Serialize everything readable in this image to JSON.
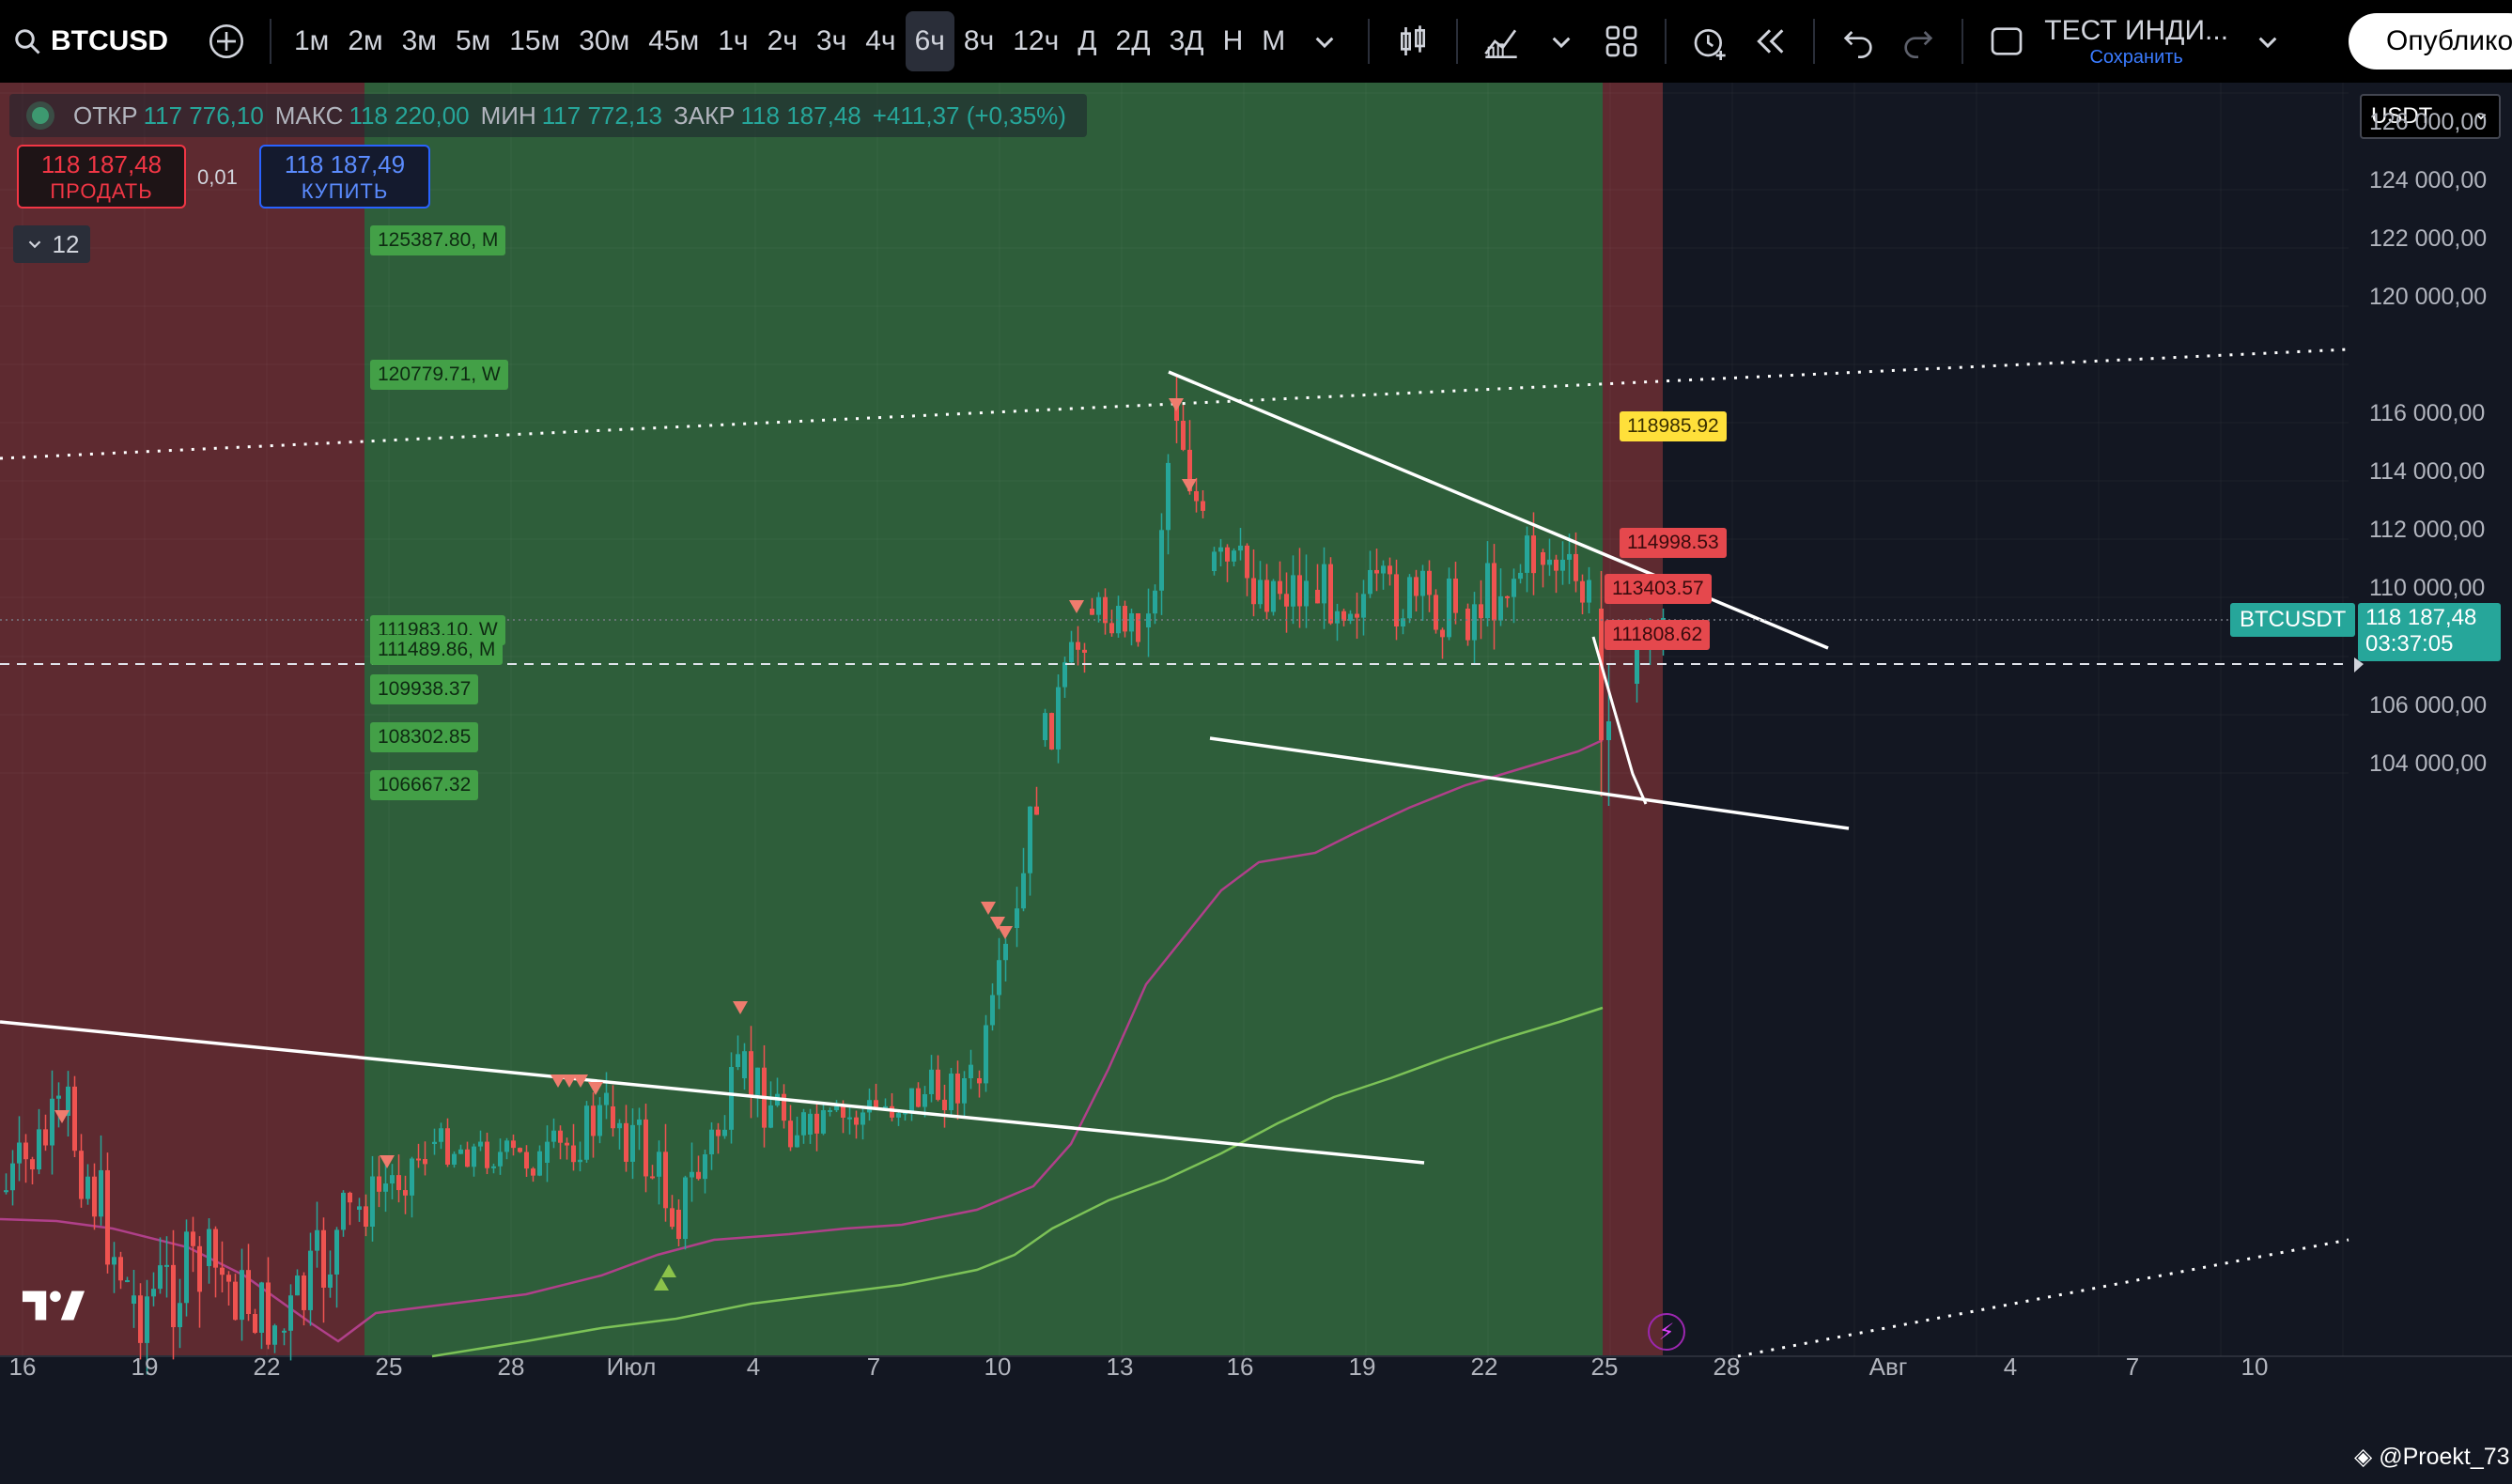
{
  "toolbar": {
    "symbol": "BTCUSD",
    "intervals": [
      "1м",
      "2м",
      "3м",
      "5м",
      "15м",
      "30м",
      "45м",
      "1ч",
      "2ч",
      "3ч",
      "4ч",
      "6ч",
      "8ч",
      "12ч",
      "Д",
      "2Д",
      "3Д",
      "Н",
      "М"
    ],
    "active_interval": "6ч",
    "layout_name": "ТЕСТ ИНДИ...",
    "layout_status": "Сохранить",
    "publish_label": "Опублико"
  },
  "legend": {
    "open_label": "ОТКР",
    "open": "117 776,10",
    "high_label": "МАКС",
    "high": "118 220,00",
    "low_label": "МИН",
    "low": "117 772,13",
    "close_label": "ЗАКР",
    "close": "118 187,48",
    "change": "+411,37 (+0,35%)"
  },
  "trade": {
    "sell_price": "118 187,48",
    "sell_label": "ПРОДАТЬ",
    "spread": "0,01",
    "buy_price": "118 187,49",
    "buy_label": "КУПИТЬ"
  },
  "indicators_count": "12",
  "currency": "USDT",
  "price_axis": [
    "126 000,00",
    "124 000,00",
    "122 000,00",
    "120 000,00",
    "116 000,00",
    "114 000,00",
    "112 000,00",
    "110 000,00",
    "108 000,00",
    "106 000,00",
    "104 000,00"
  ],
  "time_axis": [
    "16",
    "19",
    "22",
    "25",
    "28",
    "Июл",
    "4",
    "7",
    "10",
    "13",
    "16",
    "19",
    "22",
    "25",
    "28",
    "Авг",
    "4",
    "7",
    "10"
  ],
  "ticker": {
    "name": "BTCUSDT",
    "price": "118 187,48",
    "countdown": "03:37:05"
  },
  "level_labels": {
    "l1": "125387.80, M",
    "l2": "120779.71, W",
    "l3": "111983.10, W",
    "l4": "111489.86, M",
    "l5": "109938.37",
    "l6": "108302.85",
    "l7": "106667.32",
    "r1": "118985.92",
    "r2": "114998.53",
    "r3": "113403.57",
    "r4": "111808.62"
  },
  "credit": "@Proekt_73",
  "colors": {
    "up": "#26a69a",
    "down": "#ef5350",
    "bg": "#131722",
    "green_zone": "#2e5e3a",
    "red_zone": "#5e2a30"
  }
}
